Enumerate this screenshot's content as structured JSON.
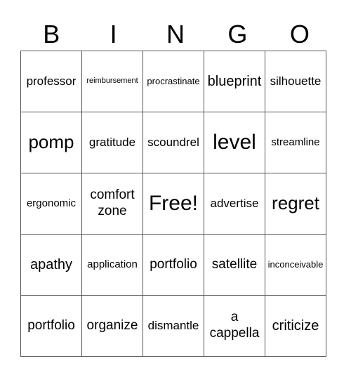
{
  "header": [
    "B",
    "I",
    "N",
    "G",
    "O"
  ],
  "rows": [
    [
      "professor",
      "reimbursement",
      "procrastinate",
      "blueprint",
      "silhouette"
    ],
    [
      "pomp",
      "gratitude",
      "scoundrel",
      "level",
      "streamline"
    ],
    [
      "ergonomic",
      "comfort zone",
      "Free!",
      "advertise",
      "regret"
    ],
    [
      "apathy",
      "application",
      "portfolio",
      "satellite",
      "inconceivable"
    ],
    [
      "portfolio",
      "organize",
      "dismantle",
      "a cappella",
      "criticize"
    ]
  ]
}
